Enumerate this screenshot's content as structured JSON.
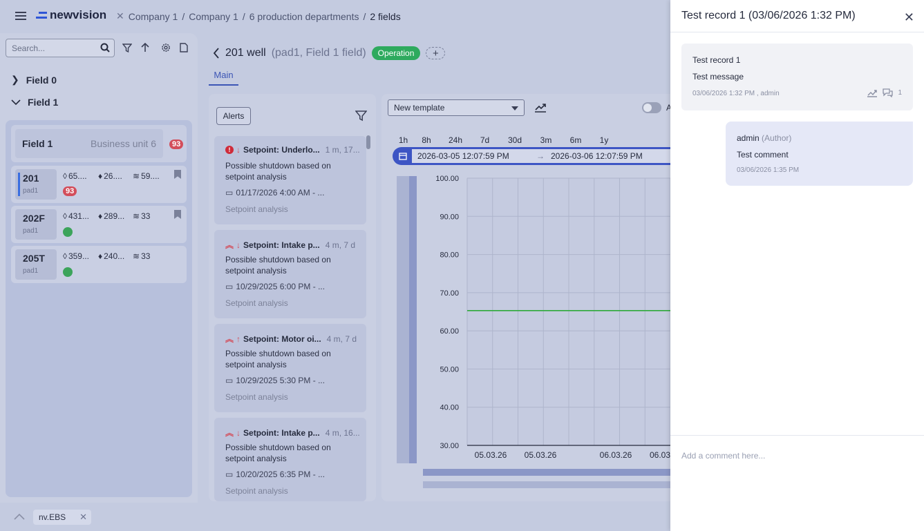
{
  "app": {
    "logo_text": "newvision"
  },
  "breadcrumb": [
    "Company 1",
    "Company 1",
    "6 production departments",
    "2 fields"
  ],
  "sidebar": {
    "search_placeholder": "Search...",
    "tree": [
      {
        "label": "Field 0"
      },
      {
        "label": "Field 1"
      }
    ],
    "field_card": {
      "name": "Field 1",
      "business_unit": "Business unit 6",
      "badge": "93"
    },
    "wells": [
      {
        "name": "201",
        "pad": "pad1",
        "v1": "65....",
        "v2": "26....",
        "v3": "59....",
        "badge": "93",
        "status": "alert"
      },
      {
        "name": "202F",
        "pad": "pad1",
        "v1": "431...",
        "v2": "289...",
        "v3": "33",
        "status": "ok"
      },
      {
        "name": "205T",
        "pad": "pad1",
        "v1": "359...",
        "v2": "240...",
        "v3": "33",
        "status": "ok"
      }
    ]
  },
  "bottom": {
    "chip_label": "nv.EBS"
  },
  "main": {
    "title": "201 well",
    "subtitle": "(pad1, Field 1 field)",
    "status_pill": "Operation",
    "plus_label": "+",
    "tab": "Main"
  },
  "alerts": {
    "button_label": "Alerts",
    "items": [
      {
        "title": "Setpoint: Underlo...",
        "ago": "1 m, 17...",
        "desc": "Possible shutdown based on setpoint analysis",
        "date": "01/17/2026 4:00 AM - ...",
        "source": "Setpoint analysis",
        "severity": "error",
        "direction": "down"
      },
      {
        "title": "Setpoint: Intake p...",
        "ago": "4 m, 7 d",
        "desc": "Possible shutdown based on setpoint analysis",
        "date": "10/29/2025 6:00 PM - ...",
        "source": "Setpoint analysis",
        "severity": "high",
        "direction": "down"
      },
      {
        "title": "Setpoint: Motor oi...",
        "ago": "4 m, 7 d",
        "desc": "Possible shutdown based on setpoint analysis",
        "date": "10/29/2025 5:30 PM - ...",
        "source": "Setpoint analysis",
        "severity": "high",
        "direction": "up"
      },
      {
        "title": "Setpoint: Intake p...",
        "ago": "4 m, 16...",
        "desc": "Possible shutdown based on setpoint analysis",
        "date": "10/20/2025 6:35 PM - ...",
        "source": "Setpoint analysis",
        "severity": "high",
        "direction": "down"
      }
    ]
  },
  "chart_panel": {
    "template_value": "New template",
    "toggle_label": "A",
    "ranges": [
      "1h",
      "8h",
      "24h",
      "7d",
      "30d",
      "3m",
      "6m",
      "1y"
    ],
    "date_from": "2026-03-05 12:07:59 PM",
    "date_to": "2026-03-06 12:07:59 PM",
    "arrow": "→"
  },
  "chart_data": {
    "type": "line",
    "y_ticks": [
      "100.00",
      "90.00",
      "80.00",
      "70.00",
      "60.00",
      "50.00",
      "40.00",
      "30.00"
    ],
    "x_ticks": [
      "05.03.26",
      "05.03.26",
      "06.03.26",
      "06.03"
    ],
    "ylim": [
      30,
      100
    ],
    "grid": true,
    "series": [
      {
        "color": "#2eaa3a",
        "values": [
          65.3,
          65.3
        ]
      }
    ]
  },
  "record_panel": {
    "title": "Test record 1 (03/06/2026 1:32 PM)",
    "record": {
      "title": "Test record 1",
      "message": "Test message",
      "meta": "03/06/2026 1:32 PM , admin",
      "comment_count": "1"
    },
    "comment": {
      "author": "admin",
      "role": "(Author)",
      "text": "Test comment",
      "time": "03/06/2026 1:35 PM"
    },
    "input_placeholder": "Add a comment here..."
  },
  "colors": {
    "accent": "#3c55b5",
    "operation": "#2eaa5e",
    "alert": "#d34e5b",
    "ok": "#3ca45b"
  }
}
